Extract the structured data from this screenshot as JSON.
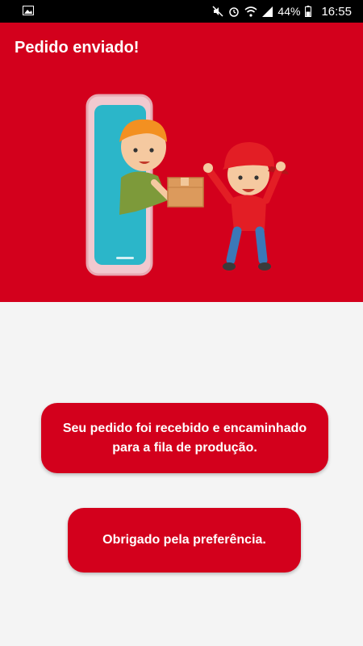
{
  "status_bar": {
    "battery_text": "44%",
    "time": "16:55",
    "icons": [
      "image-notification-icon",
      "mute-icon",
      "alarm-icon",
      "wifi-icon",
      "signal-icon",
      "battery-icon"
    ]
  },
  "header": {
    "title": "Pedido enviado!"
  },
  "illustration": {
    "name": "delivery-illustration"
  },
  "messages": {
    "received": "Seu pedido foi recebido e encaminhado para a fila de produção.",
    "thanks": "Obrigado pela preferência."
  },
  "colors": {
    "primary": "#d3001c",
    "background": "#f4f4f4"
  }
}
